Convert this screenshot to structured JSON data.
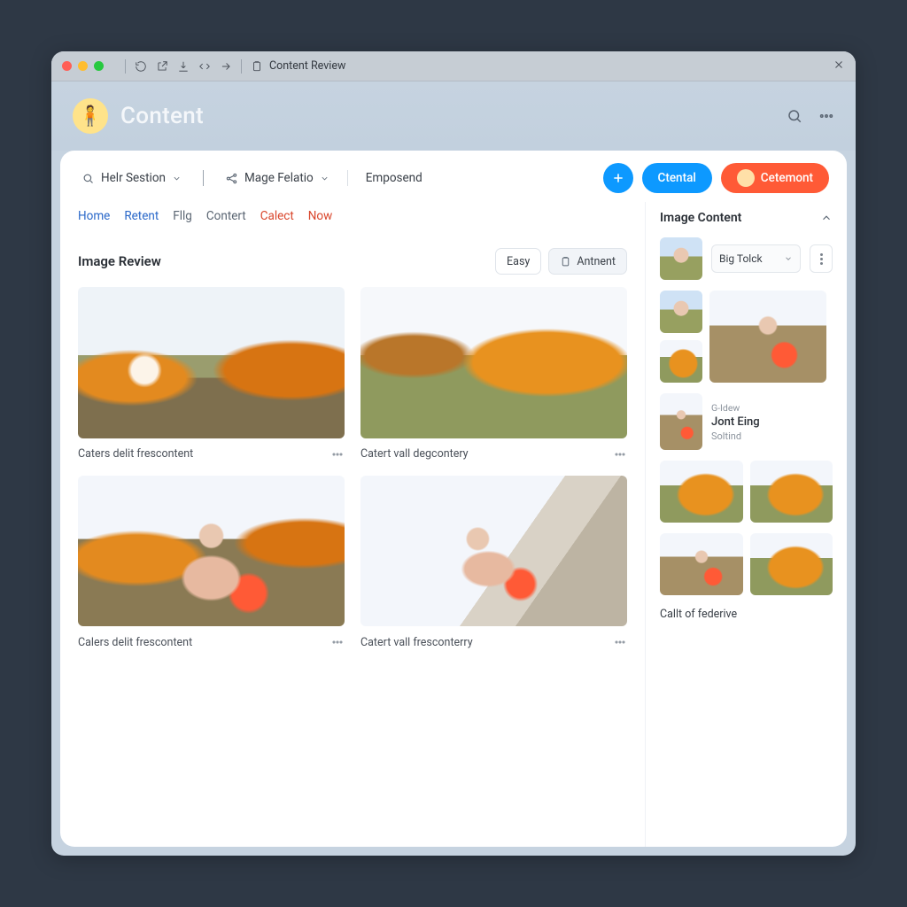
{
  "window": {
    "title": "Content Review"
  },
  "header": {
    "brand": "Content",
    "avatar_emoji": "🧍"
  },
  "toolbar": {
    "filter1": "Helr Sestion",
    "filter2": "Mage Felatio",
    "filter3": "Emposend",
    "btn_ctental": "Ctental",
    "btn_cetemont": "Cetemont"
  },
  "tabs": [
    "Home",
    "Retent",
    "Fllg",
    "Contert",
    "Calect",
    "Now"
  ],
  "section": {
    "title": "Image Review",
    "chip_easy": "Easy",
    "chip_antnent": "Antnent"
  },
  "tiles": [
    {
      "caption": "Caters delit frescontent"
    },
    {
      "caption": "Catert vall degcontery"
    },
    {
      "caption": "Calers delit frescontent"
    },
    {
      "caption": "Catert vall fresconterry"
    }
  ],
  "sidebar": {
    "title": "Image Content",
    "select_value": "Big Tolck",
    "meta": {
      "line1": "G-Idew",
      "line2": "Jont Eing",
      "line3": "Soltind"
    },
    "footer": "Callt of federive"
  }
}
